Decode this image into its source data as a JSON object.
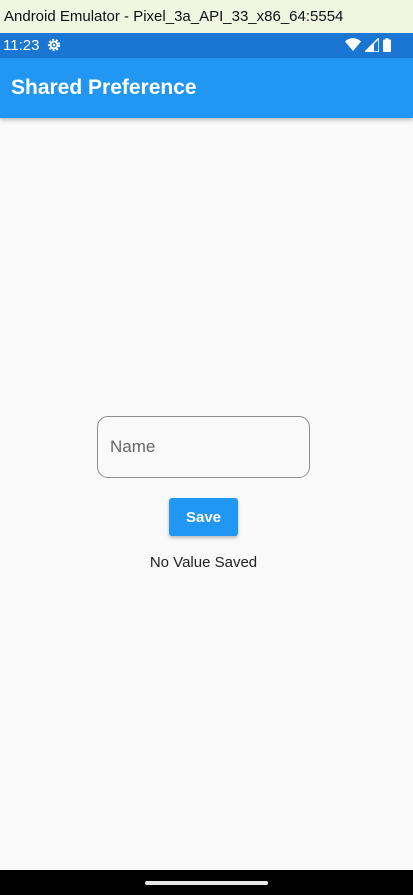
{
  "window": {
    "title": "Android Emulator - Pixel_3a_API_33_x86_64:5554"
  },
  "status_bar": {
    "time": "11:23",
    "icons": [
      "gear-icon",
      "wifi-icon",
      "signal-icon",
      "battery-icon"
    ]
  },
  "app_bar": {
    "title": "Shared Preference",
    "color": "#2196f3"
  },
  "form": {
    "name_placeholder": "Name",
    "name_value": "",
    "save_label": "Save",
    "result_text": "No Value Saved"
  },
  "colors": {
    "status_bar": "#1976d2",
    "background": "#f9f9f9",
    "primary": "#2196f3"
  }
}
